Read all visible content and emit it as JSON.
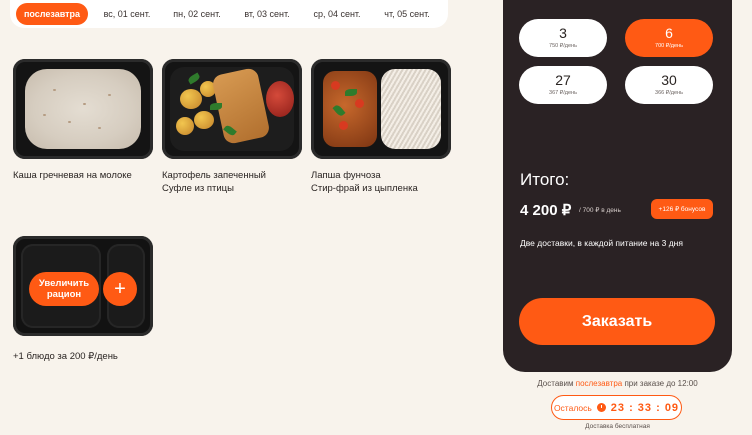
{
  "date_tabs": [
    {
      "label": "послезавтра",
      "active": true
    },
    {
      "label": "вс, 01 сент."
    },
    {
      "label": "пн, 02 сент."
    },
    {
      "label": "вт, 03 сент."
    },
    {
      "label": "ср, 04 сент."
    },
    {
      "label": "чт, 05 сент."
    }
  ],
  "meals": [
    {
      "line1": "Каша гречневая на молоке",
      "line2": ""
    },
    {
      "line1": "Картофель запеченный",
      "line2": "Суфле из птицы"
    },
    {
      "line1": "Лапша фунчоза",
      "line2": "Стир-фрай из цыпленка"
    }
  ],
  "add_portion": {
    "button_label": "Увеличить рацион",
    "plus_label": "+",
    "caption": "+1 блюдо за 200 ₽/день"
  },
  "days_options": [
    {
      "days": "3",
      "price": "750 ₽/день",
      "active": false
    },
    {
      "days": "6",
      "price": "700 ₽/день",
      "active": true
    },
    {
      "days": "27",
      "price": "367 ₽/день",
      "active": false
    },
    {
      "days": "30",
      "price": "366 ₽/день",
      "active": false
    }
  ],
  "summary": {
    "total_label": "Итого:",
    "total_price": "4 200 ₽",
    "per_day": "/ 700 ₽ в день",
    "bonus": "+126 ₽ бонусов",
    "delivery_note": "Две доставки, в каждой питание на 3 дня",
    "order_button": "Заказать"
  },
  "delivery": {
    "prefix": "Доставим",
    "highlight": "послезавтра",
    "suffix": "при заказе до 12:00",
    "timer_label": "Осталось",
    "timer_value": "23 : 33 : 09",
    "free_note": "Доставка бесплатная"
  },
  "colors": {
    "accent": "#ff5a14",
    "panel": "#2a2224",
    "background": "#f8f3ec"
  }
}
